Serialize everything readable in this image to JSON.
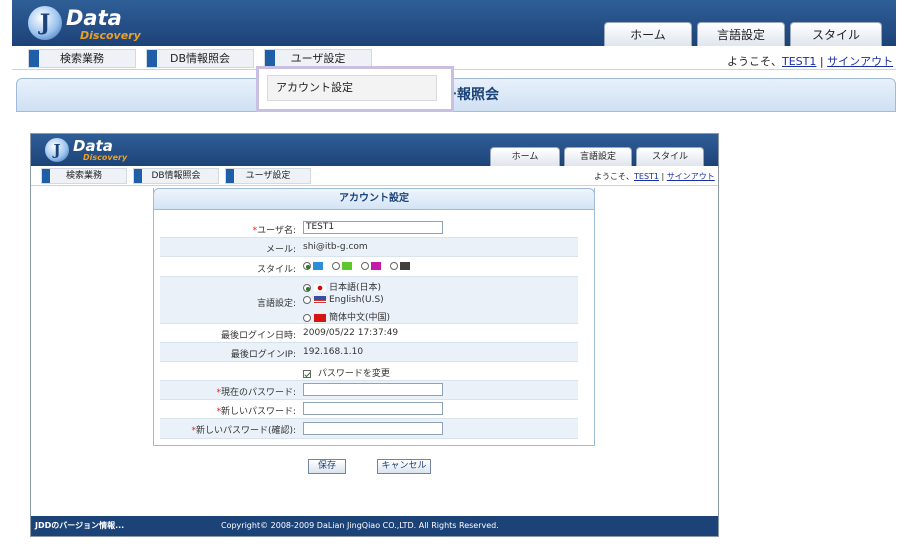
{
  "logo": {
    "letter": "J",
    "title": "Data",
    "subtitle": "Discovery"
  },
  "tabs": [
    "ホーム",
    "言語設定",
    "スタイル"
  ],
  "nav": [
    "検索業務",
    "DB情報照会",
    "ユーザ設定"
  ],
  "welcome": {
    "prefix": "ようこそ、",
    "user": "TEST1",
    "separator": "|",
    "signout": "サインアウト"
  },
  "dropdown": {
    "item": "アカウント設定"
  },
  "top_panel": {
    "title_fragment": "ー報照会"
  },
  "form": {
    "title": "アカウント設定",
    "username_label": "ユーザ名:",
    "username_required": "*",
    "username_value": "TEST1",
    "email_label": "メール:",
    "email_value": "shi@itb-g.com",
    "style_label": "スタイル:",
    "style_swatches": [
      "#2a8fd6",
      "#5ec82a",
      "#c81aa8",
      "#404040"
    ],
    "language_label": "言語設定:",
    "language_options": [
      "日本語(日本)",
      "English(U.S)",
      "簡体中文(中国)"
    ],
    "last_login_date_label": "最後ログイン日時:",
    "last_login_date_value": "2009/05/22 17:37:49",
    "last_login_ip_label": "最後ログインIP:",
    "last_login_ip_value": "192.168.1.10",
    "change_password_label": "パスワードを変更",
    "current_password_label": "現在のパスワード:",
    "new_password_label": "新しいパスワード:",
    "confirm_password_label": "新しいパスワード(確認):",
    "required_mark": "*",
    "save_button": "保存",
    "cancel_button": "キャンセル"
  },
  "footer": {
    "version": "JDDのバージョン情報...",
    "copyright": "Copyright© 2008-2009 DaLian JingQiao CO.,LTD. All Rights Reserved."
  }
}
